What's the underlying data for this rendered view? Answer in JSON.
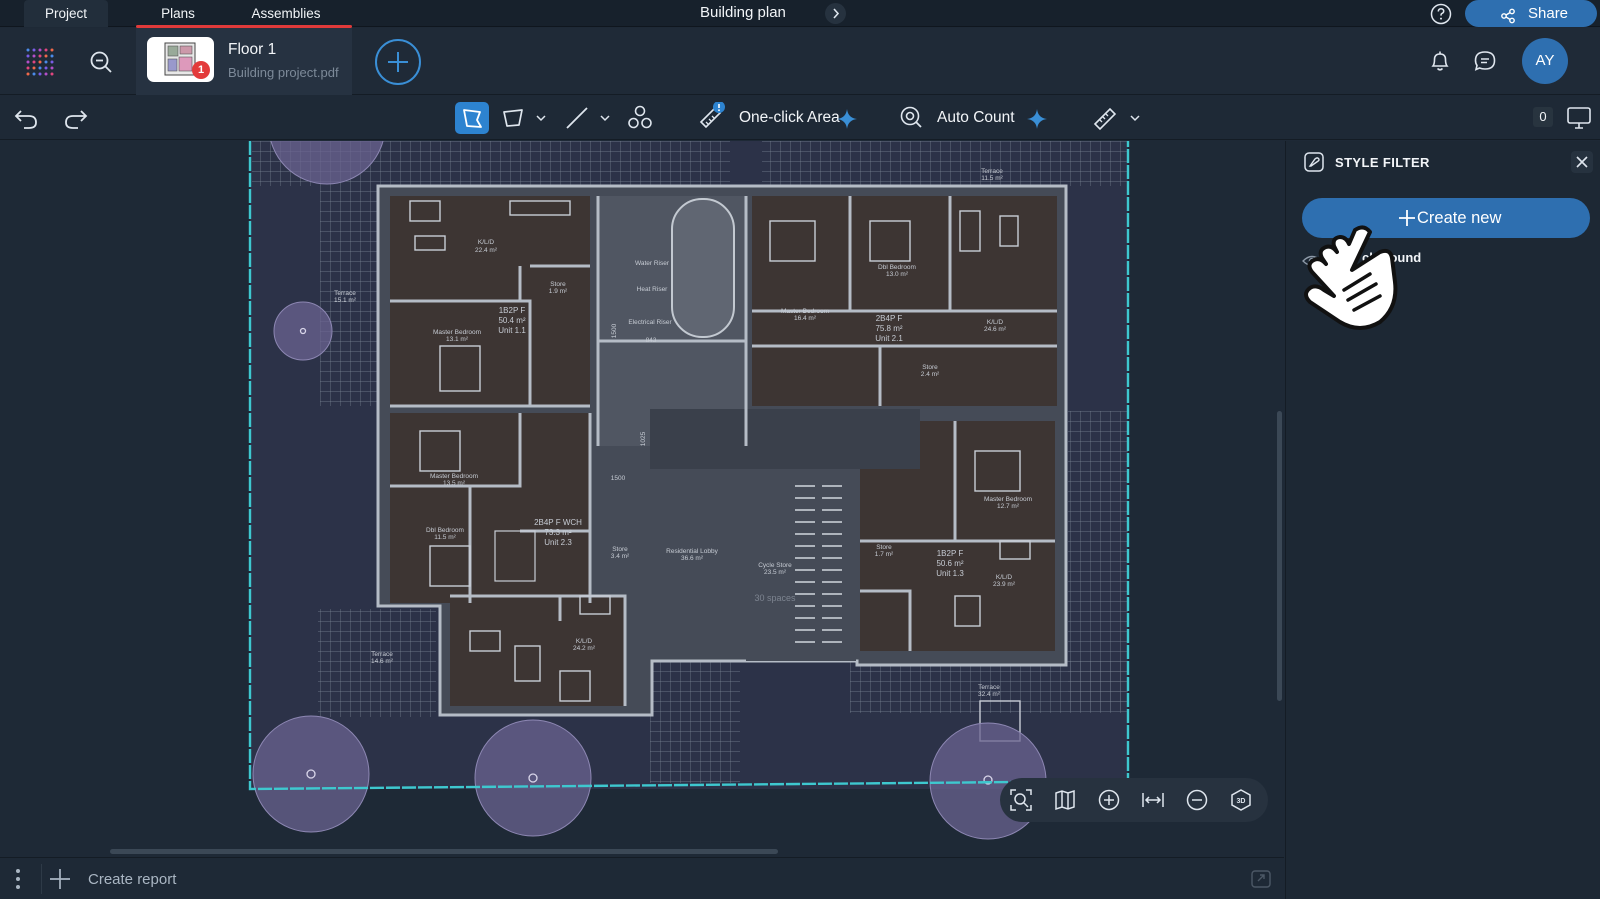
{
  "tabs": [
    {
      "label": "Project"
    },
    {
      "label": "Plans"
    },
    {
      "label": "Assemblies"
    }
  ],
  "header": {
    "title": "Building plan",
    "share_label": "Share"
  },
  "file": {
    "name": "Floor 1",
    "source": "Building project.pdf",
    "badge": "1"
  },
  "user": {
    "initials": "AY"
  },
  "toolbar": {
    "one_click_area": "One-click Area",
    "auto_count": "Auto Count",
    "layers_count": "0"
  },
  "plan": {
    "rooms": [
      {
        "name": "K/L/D",
        "area": "22.4 m²"
      },
      {
        "name": "1B2P F",
        "area": "50.4 m²",
        "unit": "Unit 1.1"
      },
      {
        "name": "Master Bedroom",
        "area": "13.1 m²"
      },
      {
        "name": "Store",
        "area": "1.9 m²"
      },
      {
        "name": "Terrace",
        "area": "15.1 m²"
      },
      {
        "name": "Master Bedroom",
        "area": "13.5 m²"
      },
      {
        "name": "Dbl Bedroom",
        "area": "11.5 m²"
      },
      {
        "name": "2B4P F WCH",
        "area": "73.3 m²",
        "unit": "Unit 2.3"
      },
      {
        "name": "Store",
        "area": "3.4 m²"
      },
      {
        "name": "K/L/D",
        "area": "24.2 m²"
      },
      {
        "name": "Terrace",
        "area": "14.6 m²"
      },
      {
        "name": "Residential Lobby",
        "area": "36.6 m²"
      },
      {
        "name": "Cycle Store",
        "area": "23.5 m²"
      },
      {
        "name": "30 spaces",
        "area": ""
      },
      {
        "name": "Dbl Bedroom",
        "area": "13.0 m²"
      },
      {
        "name": "2B4P F",
        "area": "75.8 m²",
        "unit": "Unit 2.1"
      },
      {
        "name": "Master Bedroom",
        "area": "16.4 m²"
      },
      {
        "name": "K/L/D",
        "area": "24.6 m²"
      },
      {
        "name": "Store",
        "area": "2.4 m²"
      },
      {
        "name": "Terrace",
        "area": "11.5 m²"
      },
      {
        "name": "Master Bedroom",
        "area": "12.7 m²"
      },
      {
        "name": "1B2P F",
        "area": "50.6 m²",
        "unit": "Unit 1.3"
      },
      {
        "name": "K/L/D",
        "area": "23.9 m²"
      },
      {
        "name": "Store",
        "area": "1.7 m²"
      },
      {
        "name": "Terrace",
        "area": "32.4 m²"
      }
    ],
    "core_labels": [
      "Water Riser",
      "Heat Riser",
      "Electrical Riser",
      "843",
      "1500",
      "1025",
      "1500"
    ]
  },
  "sidebar": {
    "title": "STYLE FILTER",
    "create_label": "Create new",
    "items": [
      {
        "label": "Background",
        "visible_label": "ckground"
      }
    ]
  },
  "footer": {
    "create_report": "Create report"
  },
  "colors": {
    "accent": "#2e6fb0",
    "tool_active": "#2d83d0",
    "badge": "#e33b3b",
    "underline": "#e03a3a",
    "plan_bg": "#2c3248",
    "room_fill": "#3d3533",
    "wall": "#a8afb9",
    "outline": "#3ec8cf"
  }
}
